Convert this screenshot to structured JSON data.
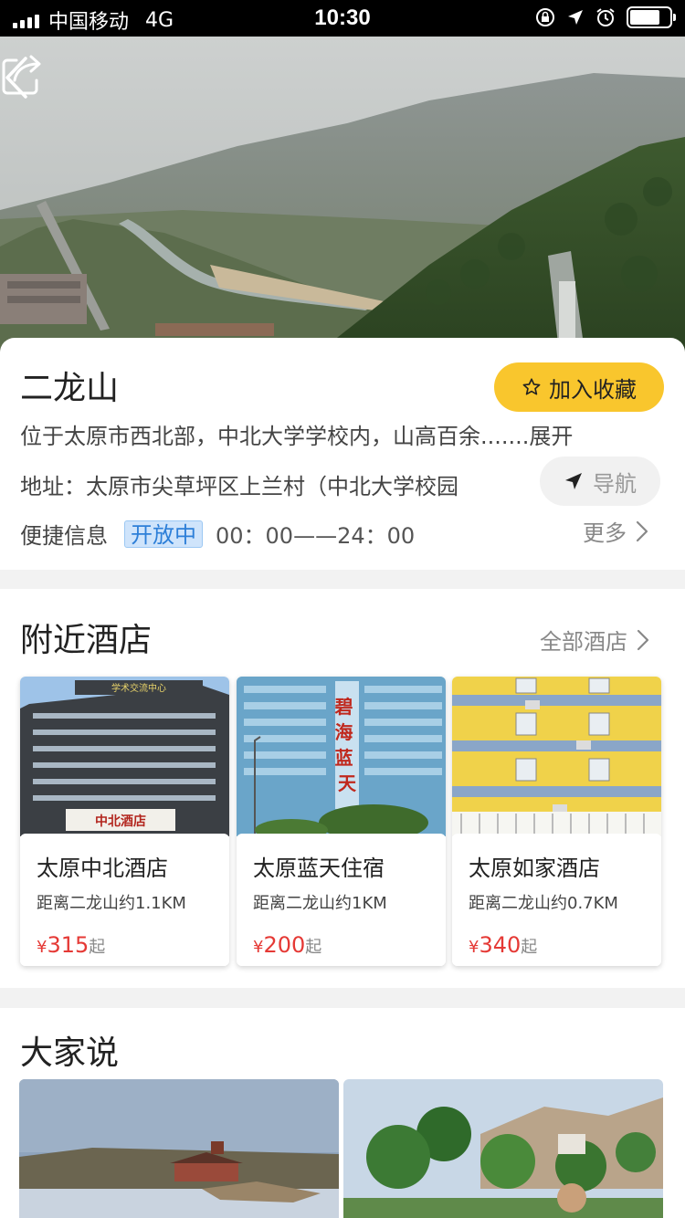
{
  "status_bar": {
    "carrier": "中国移动",
    "network": "4G",
    "time": "10:30",
    "battery_level": 0.75
  },
  "header": {
    "back_icon": "chevron-left-icon",
    "share_icon": "share-icon"
  },
  "attraction": {
    "name": "二龙山",
    "favorite_label": "加入收藏",
    "description": "位于太原市西北部，中北大学学校内，山高百余.......",
    "expand_label": "展开",
    "address": "地址：太原市尖草坪区上兰村（中北大学校园",
    "navigate_label": "导航",
    "quick_info_label": "便捷信息",
    "open_status": "开放中",
    "hours": "00：00——24：00",
    "more_label": "更多"
  },
  "hotels_section": {
    "title": "附近酒店",
    "all_label": "全部酒店",
    "hotels": [
      {
        "name": "太原中北酒店",
        "distance": "距离二龙山约1.1KM",
        "currency": "¥",
        "price": "315",
        "unit": "起",
        "sign_text": "中北酒店",
        "roof_text": "学术交流中心"
      },
      {
        "name": "太原蓝天住宿",
        "distance": "距离二龙山约1KM",
        "currency": "¥",
        "price": "200",
        "unit": "起",
        "sign_text": "碧海蓝天"
      },
      {
        "name": "太原如家酒店",
        "distance": "距离二龙山约0.7KM",
        "currency": "¥",
        "price": "340",
        "unit": "起"
      }
    ]
  },
  "comments_section": {
    "title": "大家说"
  },
  "colors": {
    "accent_yellow": "#f9c62d",
    "price_red": "#e53935",
    "open_badge_blue": "#2d7fd8"
  }
}
